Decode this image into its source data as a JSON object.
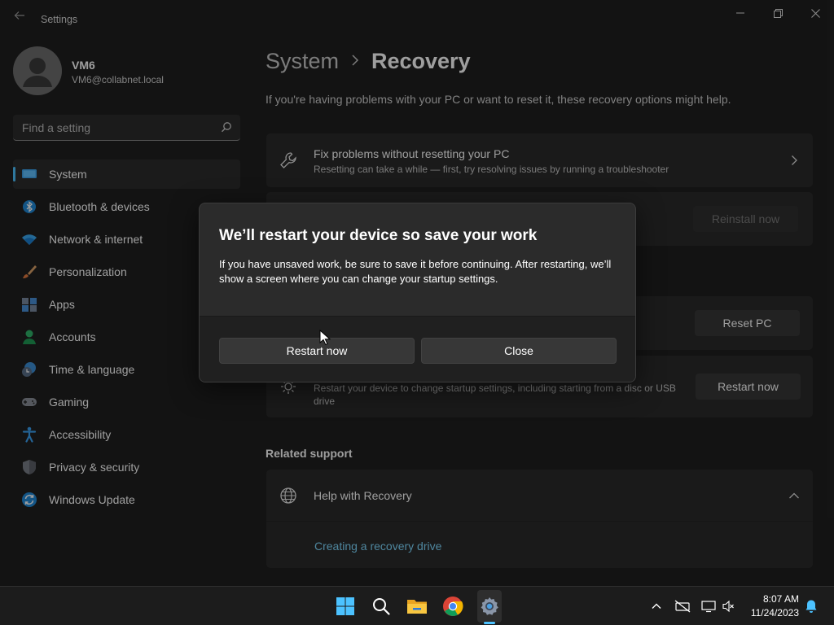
{
  "window": {
    "title": "Settings",
    "back_icon": "back-arrow-icon",
    "controls": [
      "minimize-icon",
      "maximize-icon",
      "close-icon"
    ]
  },
  "profile": {
    "name": "VM6",
    "email": "VM6@collabnet.local"
  },
  "search": {
    "placeholder": "Find a setting",
    "value": ""
  },
  "sidebar": {
    "items": [
      {
        "label": "System",
        "icon": "system-icon",
        "active": true
      },
      {
        "label": "Bluetooth & devices",
        "icon": "bluetooth-icon"
      },
      {
        "label": "Network & internet",
        "icon": "wifi-icon"
      },
      {
        "label": "Personalization",
        "icon": "brush-icon"
      },
      {
        "label": "Apps",
        "icon": "apps-icon"
      },
      {
        "label": "Accounts",
        "icon": "accounts-icon"
      },
      {
        "label": "Time & language",
        "icon": "time-language-icon"
      },
      {
        "label": "Gaming",
        "icon": "gamepad-icon"
      },
      {
        "label": "Accessibility",
        "icon": "accessibility-icon"
      },
      {
        "label": "Privacy & security",
        "icon": "shield-icon"
      },
      {
        "label": "Windows Update",
        "icon": "update-icon"
      }
    ]
  },
  "main": {
    "breadcrumb_parent": "System",
    "breadcrumb_current": "Recovery",
    "description": "If you're having problems with your PC or want to reset it, these recovery options might help.",
    "fix_card": {
      "title": "Fix problems without resetting your PC",
      "subtitle": "Resetting can take a while — first, try resolving issues by running a troubleshooter"
    },
    "reinstall_button": "Reinstall now",
    "reset_button": "Reset PC",
    "advanced_card": {
      "subtitle": "Restart your device to change startup settings, including starting from a disc or USB drive",
      "button": "Restart now"
    },
    "related_support": "Related support",
    "help_card": {
      "title": "Help with Recovery",
      "link": "Creating a recovery drive"
    }
  },
  "dialog": {
    "title": "We’ll restart your device so save your work",
    "body": "If you have unsaved work, be sure to save it before continuing. After restarting, we’ll show a screen where you can change your startup settings.",
    "restart_button": "Restart now",
    "close_button": "Close"
  },
  "taskbar": {
    "icons": [
      "windows-start-icon",
      "search-icon",
      "file-explorer-icon",
      "chrome-icon",
      "settings-icon"
    ],
    "active_app": "settings-icon",
    "tray_icons": [
      "chevron-up-icon",
      "network-off-icon",
      "display-icon",
      "volume-mute-icon"
    ],
    "time": "8:07 AM",
    "date": "11/24/2023",
    "notification_icon": "notification-bell-icon"
  },
  "colors": {
    "accent": "#4cc2ff",
    "background": "#202020",
    "card": "#2b2b2b",
    "link": "#7fd8ff"
  }
}
